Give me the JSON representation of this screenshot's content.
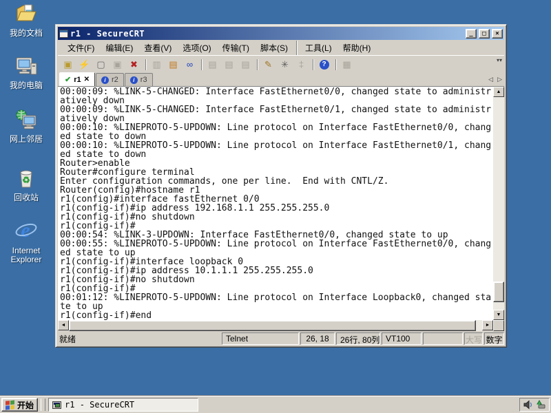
{
  "desktop": {
    "background_color": "#3a6ea5",
    "icons": [
      {
        "name": "my-documents",
        "label": "我的文档"
      },
      {
        "name": "my-computer",
        "label": "我的电脑"
      },
      {
        "name": "network-places",
        "label": "网上邻居"
      },
      {
        "name": "recycle-bin",
        "label": "回收站"
      },
      {
        "name": "internet-explorer",
        "label": "Internet Explorer"
      }
    ]
  },
  "window": {
    "title": "r1 - SecureCRT",
    "controls": {
      "minimize": "_",
      "maximize": "□",
      "close": "×"
    },
    "menu": [
      {
        "name": "menu-file",
        "label": "文件(F)"
      },
      {
        "name": "menu-edit",
        "label": "编辑(E)"
      },
      {
        "name": "menu-view",
        "label": "查看(V)"
      },
      {
        "name": "menu-options",
        "label": "选项(O)"
      },
      {
        "name": "menu-transfer",
        "label": "传输(T)"
      },
      {
        "name": "menu-script",
        "label": "脚本(S)"
      },
      {
        "name": "menu-tools",
        "label": "工具(L)",
        "sep": true
      },
      {
        "name": "menu-help",
        "label": "帮助(H)"
      }
    ],
    "toolbar": [
      {
        "name": "connect-dialog-icon",
        "glyph": "▣",
        "color": "#b89a30"
      },
      {
        "name": "quick-connect-icon",
        "glyph": "⚡",
        "color": "#c09020"
      },
      {
        "name": "new-session-icon",
        "glyph": "▢",
        "color": "#6a6a6a"
      },
      {
        "name": "reconnect-icon",
        "glyph": "▣",
        "disabled": true
      },
      {
        "name": "disconnect-icon",
        "glyph": "✖",
        "color": "#b42222"
      },
      {
        "name": "toolbar-separator",
        "sep": true
      },
      {
        "name": "copy-icon",
        "glyph": "▥",
        "disabled": true
      },
      {
        "name": "paste-icon",
        "glyph": "▤",
        "color": "#c07820"
      },
      {
        "name": "find-icon",
        "glyph": "∞",
        "color": "#2244bb"
      },
      {
        "name": "toolbar-separator",
        "sep": true
      },
      {
        "name": "print-icon",
        "glyph": "▤",
        "disabled": true
      },
      {
        "name": "print-preview-icon",
        "glyph": "▤",
        "disabled": true
      },
      {
        "name": "print-setup-icon",
        "glyph": "▤",
        "disabled": true
      },
      {
        "name": "toolbar-separator",
        "sep": true
      },
      {
        "name": "session-options-icon",
        "glyph": "✎",
        "color": "#a07828"
      },
      {
        "name": "global-options-icon",
        "glyph": "✳",
        "color": "#5a5a5a"
      },
      {
        "name": "key-icon",
        "glyph": "‡",
        "disabled": true
      },
      {
        "name": "toolbar-separator",
        "sep": true
      },
      {
        "name": "help-icon",
        "glyph": "?",
        "help": true
      },
      {
        "name": "toolbar-separator",
        "sep": true
      },
      {
        "name": "auto-hide-icon",
        "glyph": "▦",
        "disabled": true
      }
    ],
    "tabs": {
      "active_icon": "✔",
      "close_icon": "✕",
      "info_icon": "i",
      "items": [
        {
          "name": "tab-r1",
          "label": "r1",
          "active": true
        },
        {
          "name": "tab-r2",
          "label": "r2"
        },
        {
          "name": "tab-r3",
          "label": "r3"
        }
      ]
    },
    "terminal": {
      "lines": [
        "00:00:09: %LINK-5-CHANGED: Interface FastEthernet0/0, changed state to administr",
        "atively down",
        "00:00:09: %LINK-5-CHANGED: Interface FastEthernet0/1, changed state to administr",
        "atively down",
        "00:00:10: %LINEPROTO-5-UPDOWN: Line protocol on Interface FastEthernet0/0, chang",
        "ed state to down",
        "00:00:10: %LINEPROTO-5-UPDOWN: Line protocol on Interface FastEthernet0/1, chang",
        "ed state to down",
        "Router>enable",
        "Router#configure terminal",
        "Enter configuration commands, one per line.  End with CNTL/Z.",
        "Router(config)#hostname r1",
        "r1(config)#interface fastEthernet 0/0",
        "r1(config-if)#ip address 192.168.1.1 255.255.255.0",
        "r1(config-if)#no shutdown",
        "r1(config-if)#",
        "00:00:54: %LINK-3-UPDOWN: Interface FastEthernet0/0, changed state to up",
        "00:00:55: %LINEPROTO-5-UPDOWN: Line protocol on Interface FastEthernet0/0, chang",
        "ed state to up",
        "r1(config-if)#interface loopback 0",
        "r1(config-if)#ip address 10.1.1.1 255.255.255.0",
        "r1(config-if)#no shutdown",
        "r1(config-if)#",
        "00:01:12: %LINEPROTO-5-UPDOWN: Line protocol on Interface Loopback0, changed sta",
        "te to up",
        "r1(config-if)#end"
      ]
    },
    "statusbar": {
      "ready": "就绪",
      "protocol": "Telnet",
      "cursor_pos": "26, 18",
      "screen_size": "26行, 80列",
      "emulation": "VT100",
      "caps_indicator": "大写",
      "num_indicator": "数字"
    }
  },
  "taskbar": {
    "start_label": "开始",
    "task_label": "r1 - SecureCRT"
  }
}
